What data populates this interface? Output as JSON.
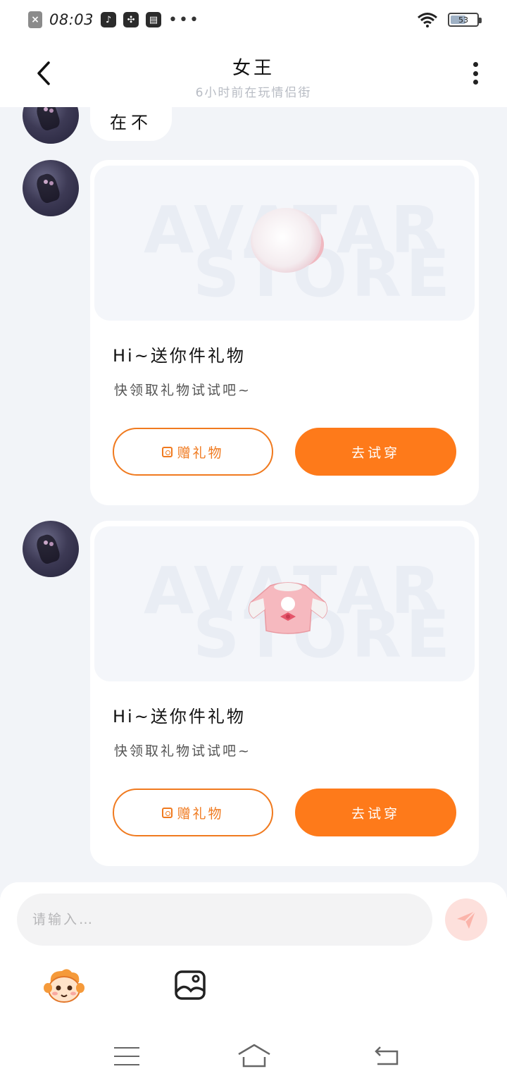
{
  "status_bar": {
    "time": "08:03",
    "battery": "53"
  },
  "header": {
    "title": "女王",
    "subtitle": "6小时前在玩情侣街"
  },
  "messages": [
    {
      "type": "text",
      "text": "在不"
    },
    {
      "type": "gift",
      "watermark_line1": "AVATAR",
      "watermark_line2": "STORE",
      "item": "fur-pompom",
      "title": "Hi~送你件礼物",
      "subtitle": "快领取礼物试试吧~",
      "gift_button": "赠礼物",
      "try_button": "去试穿"
    },
    {
      "type": "gift",
      "watermark_line1": "AVATAR",
      "watermark_line2": "STORE",
      "item": "pink-sweater",
      "title": "Hi~送你件礼物",
      "subtitle": "快领取礼物试试吧~",
      "gift_button": "赠礼物",
      "try_button": "去试穿"
    }
  ],
  "input": {
    "placeholder": "请输入…",
    "value": ""
  },
  "icons": {
    "back": "chevron-left-icon",
    "more": "more-vertical-icon",
    "send": "paper-plane-icon",
    "emoji": "mascot-face-icon",
    "image": "image-icon",
    "nav_menu": "menu-icon",
    "nav_home": "home-icon",
    "nav_back": "return-icon"
  },
  "colors": {
    "accent": "#fe7a1a",
    "send_button_bg": "#fde0dc",
    "background": "#f2f4f8"
  }
}
